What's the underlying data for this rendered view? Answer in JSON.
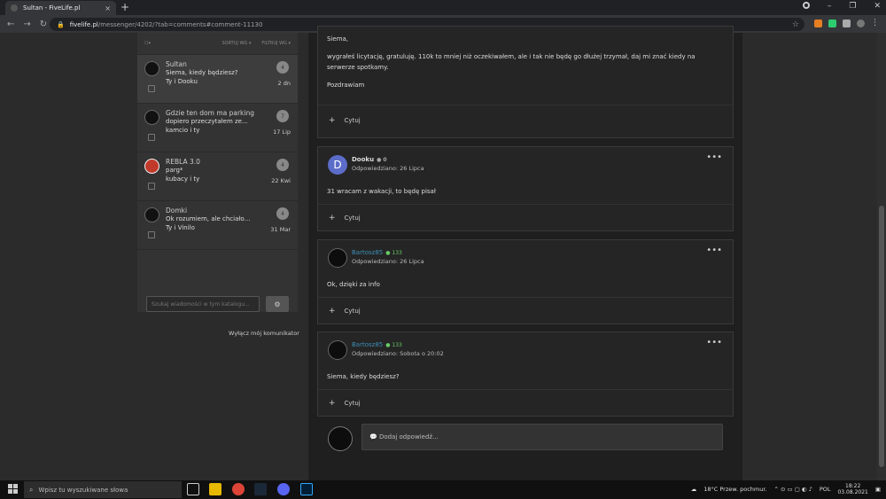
{
  "browser": {
    "tab_title": "Sultan - FiveLife.pl",
    "tab_close": "×",
    "new_tab": "+",
    "url_host": "fivelife.pl",
    "url_path": "/messenger/4202/?tab=comments#comment-11130",
    "win_min": "–",
    "win_max": "❐",
    "win_close": "✕",
    "back": "←",
    "forward": "→",
    "reload": "↻",
    "lock": "🔒",
    "star": "☆"
  },
  "sidebar": {
    "sort_label": "SORTUJ WG ▾",
    "filter_label": "FILTRUJ WG ▾",
    "conversations": [
      {
        "name": "Sultan",
        "preview": "Siema, kiedy będziesz?",
        "participants": "Ty i Dooku",
        "count": "4",
        "date": "2 dn"
      },
      {
        "name": "Gdzie ten dom ma parking",
        "preview": "dopiero przeczytałem ze...",
        "participants": "kamcio i ty",
        "count": "7",
        "date": "17 Lip"
      },
      {
        "name": "REBLA 3.0",
        "preview": "parg*",
        "participants": "kubacy i ty",
        "count": "4",
        "date": "22 Kwi"
      },
      {
        "name": "Domki",
        "preview": "Ok rozumiem, ale chciałom...",
        "participants": "Ty i Vinilo",
        "count": "4",
        "date": "31 Mar"
      }
    ],
    "search_placeholder": "Szukaj wiadomości w tym katalogu...",
    "gear": "⚙",
    "disable_link": "Wyłącz mój komunikator"
  },
  "posts": [
    {
      "lines": [
        "Siema,",
        "wygrałeś licytację, gratuluję. 110k to mniej niż oczekiwałem, ale i tak nie będę go dłużej trzymał, daj mi znać kiedy na serwerze spotkamy.",
        "Pozdrawiam"
      ],
      "quote": "Cytuj"
    },
    {
      "author": "Dooku",
      "rep": "● 0",
      "initial": "D",
      "replied": "Odpowiedziano: 26 Lipca",
      "text": "31 wracam z wakacji, to będę pisał",
      "quote": "Cytuj",
      "menu": "•••"
    },
    {
      "author": "Bartosz85",
      "rep": "● 133",
      "replied": "Odpowiedziano: 26 Lipca",
      "text": "Ok, dzięki za info",
      "quote": "Cytuj",
      "menu": "•••"
    },
    {
      "author": "Bartosz85",
      "rep": "● 133",
      "replied": "Odpowiedziano: Sobota o 20:02",
      "text": "Siema, kiedy będziesz?",
      "quote": "Cytuj",
      "menu": "•••"
    }
  ],
  "reply_placeholder": "💬 Dodaj odpowiedź...",
  "taskbar": {
    "search_placeholder": "Wpisz tu wyszukiwane słowa",
    "weather": "18°C  Przew. pochmur.",
    "lang": "POL",
    "time": "18:22",
    "date": "03.08.2021"
  },
  "colors": {
    "accent_blue": "#3d8fb8",
    "rep_green": "#66cc66",
    "avatar_d": "#5b6cc9"
  }
}
